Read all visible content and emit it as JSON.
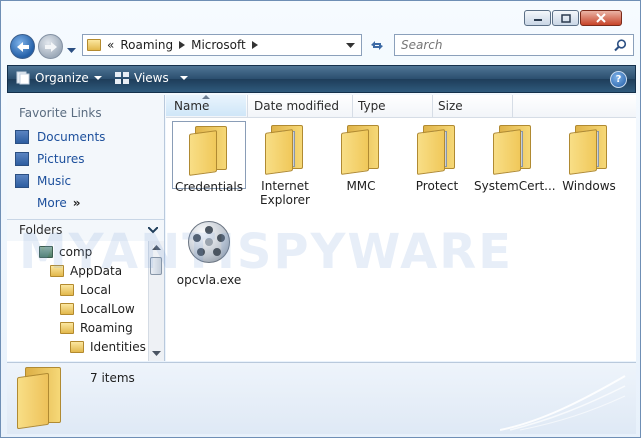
{
  "window": {
    "controls": [
      "minimize",
      "maximize",
      "close"
    ]
  },
  "address": {
    "overflow": "«",
    "crumbs": [
      "Roaming",
      "Microsoft"
    ],
    "search_placeholder": "Search"
  },
  "toolbar": {
    "organize": "Organize",
    "views": "Views",
    "help": "?"
  },
  "nav": {
    "favorite_title": "Favorite Links",
    "links": [
      {
        "label": "Documents",
        "icon": "documents-icon"
      },
      {
        "label": "Pictures",
        "icon": "pictures-icon"
      },
      {
        "label": "Music",
        "icon": "music-icon"
      }
    ],
    "more": "More",
    "more_glyph": "»",
    "folders_title": "Folders",
    "tree": [
      {
        "label": "comp"
      },
      {
        "label": "AppData"
      },
      {
        "label": "Local"
      },
      {
        "label": "LocalLow"
      },
      {
        "label": "Roaming"
      },
      {
        "label": "Identities"
      }
    ]
  },
  "columns": [
    "Name",
    "Date modified",
    "Type",
    "Size"
  ],
  "items": [
    {
      "label": "Credentials",
      "kind": "folder"
    },
    {
      "label": "Internet Explorer",
      "kind": "folder"
    },
    {
      "label": "MMC",
      "kind": "folder"
    },
    {
      "label": "Protect",
      "kind": "folder"
    },
    {
      "label": "SystemCert...",
      "kind": "folder"
    },
    {
      "label": "Windows",
      "kind": "folder"
    },
    {
      "label": "opcvla.exe",
      "kind": "exe"
    }
  ],
  "status": {
    "count": "7 items"
  },
  "watermark": "MYANTISPYWARE",
  "colors": {
    "toolbar": "#2b4e6e",
    "link": "#1c4f9c",
    "folder": "#f0c85a"
  }
}
